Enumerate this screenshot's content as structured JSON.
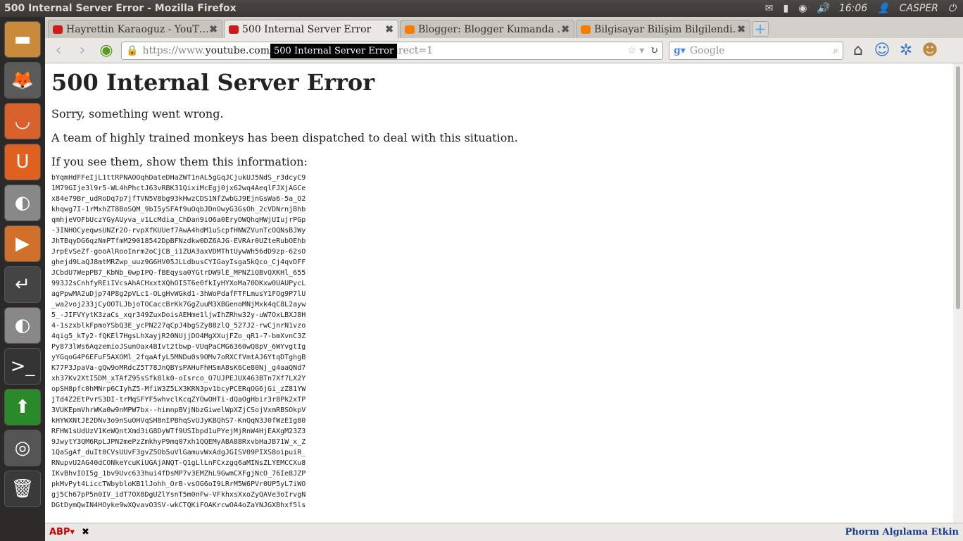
{
  "window": {
    "title": "500 Internal Server Error - Mozilla Firefox"
  },
  "panel": {
    "time": "16:06",
    "user": "CASPER",
    "icons": [
      "mail-icon",
      "battery-icon",
      "network-icon",
      "volume-icon",
      "user-icon",
      "power-icon"
    ]
  },
  "launcher": {
    "items": [
      "files-icon",
      "firefox-icon",
      "software-center-icon",
      "ubuntu-one-icon",
      "toggle-off-icon",
      "media-icon",
      "return-icon",
      "toggle-off-icon",
      "terminal-icon",
      "update-icon",
      "chrome-icon",
      "trash-icon"
    ]
  },
  "tabs": [
    {
      "label": "Hayrettin Karaoguz - YouT…",
      "favicon": "youtube-icon",
      "color": "#cc1b1b"
    },
    {
      "label": "500 Internal Server Error",
      "favicon": "youtube-icon",
      "color": "#cc1b1b",
      "active": true
    },
    {
      "label": "Blogger: Blogger Kumanda …",
      "favicon": "blogger-icon",
      "color": "#f57d00"
    },
    {
      "label": "Bilgisayar Bilişim Bilgilendi…",
      "favicon": "blogger-icon",
      "color": "#f57d00"
    }
  ],
  "nav": {
    "url_prefix": "https://www.",
    "url_domain": "youtube.com",
    "url_rest": "/…&feature=plcp&noredirect=1",
    "search_placeholder": "Google",
    "tooltip": "500 Internal Server Error"
  },
  "page": {
    "heading": "500 Internal Server Error",
    "p1": "Sorry, something went wrong.",
    "p2": "A team of highly trained monkeys has been dispatched to deal with this situation.",
    "p3": "If you see them, show them this information:",
    "code": "bYqmHdFFeIjL1ttRPNAOOqhDateDHaZWT1nAL5gGqJCjukUJ5NdS_r3dcyC9\n1M79GIje3l9r5-WL4hPhctJ63vRBK31QixiMcEgj0jx62wq4AeqlFJXjAGCe\nx84e79Br_udRoDq7p7jfTVN5V8bg93kHwzCDS1NfZwbGJ9EjnGsWa6-5a_O2\nkhqwg7I-1rMxhZT8BoSQM_9bI5ySFAf9uOqbJDnOwyG3GsOh_2cVDNrnjBhb\nqmhjeVOFbUczYGyAUyva_v1LcMdia_ChDan9iO6a0EryOWQhqHWjUIujrPGp\n-3INHOCyeqwsUNZr2O-rvpXfKUUef7AwA4hdM1uScpfHNWZVunTcOQNsBJWy\nJhTBqyDG6qzNmPTfmM29018542DpBFNzdkw0DZ6AJG-EVRAr0UZteRubOEhb\nJrpEvSeZf-gooAlRooInrm2oCjCB_i1ZUA3axVDMThtUywWh56dD9zp-62sO\nghejd9LaQJ8mtMRZwp_uuz9G6HV05JLLdbusCYIGayIsga5kQco_Cj4qvDFF\nJCbdU7WepPB7_KbNb_0wpIPQ-fBEqysa0YGtrDW9lE_MPNZiQBvQXKHl_655\n993J2sCnhfyREiIVcsAhACHxxtXQhOI5T6e0fkIyHYXoMa70DKxw0UAUPycL\nagPpwMA2uDjp74P8g2pVLc1-OLgHvWGkd1-3hWoPdafFTFLmusY1FOg9P7lU\n_wa2voj233jCyOOTLJbjoTOCaccBrKk7GgZuuM3XBGenoMNjMxk4qC8L2ayw\n5_-JIFVYytK3zaCs_xqr349ZuxDoisAEHme1ljwIhZRhw32y-uW7OxLBXJ8H\n4-1szxblkFpmoYSbQ3E_ycPN227qCpJ4bgSZy88zlQ_527J2-rwCjnrN1vzo\n4qig5_kTy2-fQKEl7HgsLhXayjR20NUjjDO4MgXXujFZo_qR1-7-bmXvnC3Z\nPy873lWs6AqzemioJSunOax4BIvt2tbwp-VUqPaCMG6360wQ8pV_6WYvgtIg\nyYGqoG4P6EFuF5AXOMl_2fqaAfyL5MNDu0s9OMv7oRXCfVmtAJ6YtqDTghgB\nK77P3JpaVa-gQw9oMRdcZ5T78JnQBYsPAHuFhHSmA8sK6Ce80Nj_g4aaQNd7\nxh37Kv2XtI5DM_xTAfZ95sSfk8lk0-oIsrco_O7UJPEJUX463BTn7Xf7LX2Y\nopSH8pfc0hMNrp6CIyhZ5-MfiW3Z5LX3KRN3pv1bcyPCERqOG6jGi_zZ81YW\njTd4Z2EtPvrS3DI-trMqSFYF5whvclKcqZYOwOHTi-dQaOgHbir3r8Pk2xTP\n3VUKEpmVhrWKa0w9nMPW7bx--himnpBVjNbzGiwelWpXZjCSojVxmRBSOkpV\nkHYWXNtJE2DNv3o9nSuOHVqSH8nIPBhqSvUJyKBQhS7-KnQqN3J0fWzEIg80\nRFHW1sUdUzV1KeWQntXmd3iG8DyWTf9USIbpd1uPYejMjRnW4HjEAXgM23Z3\n9JwytY3QM6RpLJPN2mePzZmkhyP9mq07xh1QQEMyABA88RxvbHaJB71W_x_Z\n1QaSgAf_duIt0CVsUUvF3gvZ5Ob5uVlGamuvWxAdgJGISV09PIXS8oipuiR_\nRNupvU2AG40dCONkeYcuKiUGAjANQT-Q1gLlLnFCxzgq6aMINsZLYEMCCXu8\nIKvBhvIOI5g_1bv9Uvc633hui4fDsMP7v3EMZhL9GwmCXFgjNcO_76Ie8JZP\npkMvPyt4LiccTWbybloKB1lJohh_OrB-vsOG6oI9LRrM5W6PVr0UP5yL7iWO\ngj5Ch67pP5n0IV_idT7OX8DgUZlYsnT5m0nFw-VFkhxsXxoZyQAVe3oIrvgN\nDGtDymQwIN4HOyke9wXQvavO3SV-wkCTQKiFOAKrcwOA4oZaYNJGXBhxf5ls"
  },
  "status": {
    "right_text": "Phorm Algılama Etkin"
  }
}
